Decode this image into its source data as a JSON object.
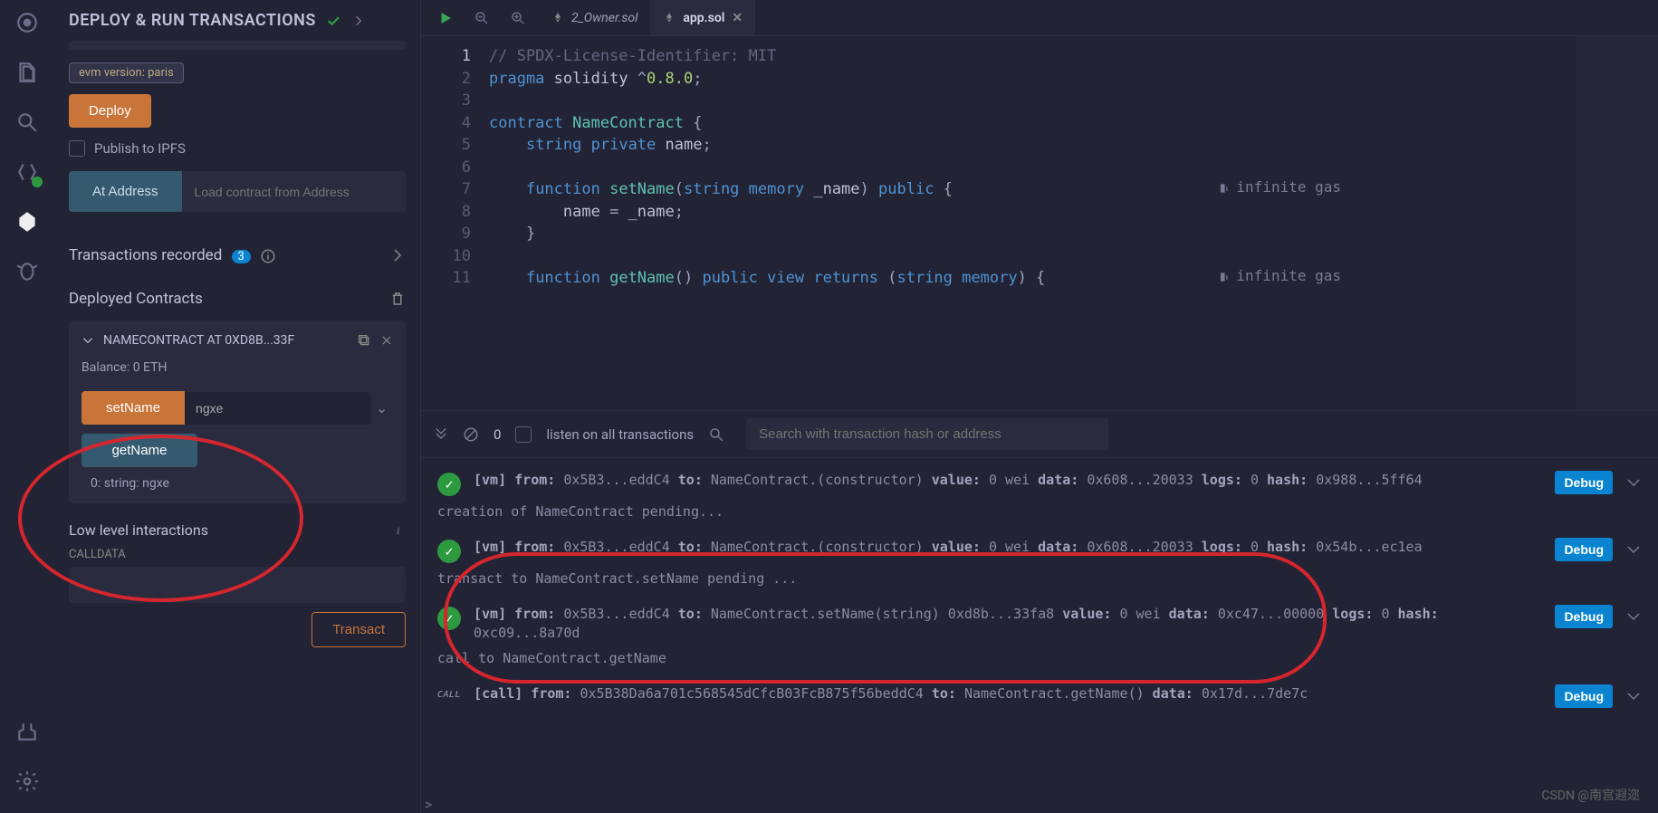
{
  "panel": {
    "title": "DEPLOY & RUN TRANSACTIONS",
    "evm_badge": "evm version: paris",
    "deploy_label": "Deploy",
    "publish_ipfs": "Publish to IPFS",
    "at_address_label": "At Address",
    "at_address_placeholder": "Load contract from Address",
    "tx_recorded": "Transactions recorded",
    "tx_recorded_count": "3",
    "deployed_contracts": "Deployed Contracts",
    "low_level": "Low level interactions",
    "calldata_label": "CALLDATA",
    "transact_label": "Transact"
  },
  "contract": {
    "name": "NAMECONTRACT AT 0XD8B...33F",
    "balance": "Balance: 0 ETH",
    "functions": [
      {
        "name": "setName",
        "input_value": "ngxe",
        "kind": "orange"
      },
      {
        "name": "getName",
        "kind": "blue"
      }
    ],
    "return_value": "0: string: ngxe"
  },
  "tabs": [
    {
      "label": "2_Owner.sol",
      "active": false
    },
    {
      "label": "app.sol",
      "active": true
    }
  ],
  "editor": {
    "lines": [
      {
        "n": 1,
        "tokens": [
          [
            "// SPDX-License-Identifier: MIT",
            "c-comment"
          ]
        ]
      },
      {
        "n": 2,
        "tokens": [
          [
            "pragma",
            "c-kw"
          ],
          [
            " ",
            "c-punc"
          ],
          [
            "solidity",
            "c-id"
          ],
          [
            " ^",
            "c-punc"
          ],
          [
            "0.8.0",
            "c-num"
          ],
          [
            ";",
            "c-punc"
          ]
        ]
      },
      {
        "n": 3,
        "tokens": []
      },
      {
        "n": 4,
        "tokens": [
          [
            "contract",
            "c-kw"
          ],
          [
            " ",
            "c-punc"
          ],
          [
            "NameContract",
            "c-type"
          ],
          [
            " {",
            "c-punc"
          ]
        ]
      },
      {
        "n": 5,
        "tokens": [
          [
            "    ",
            "c-punc"
          ],
          [
            "string",
            "c-kw"
          ],
          [
            " ",
            "c-punc"
          ],
          [
            "private",
            "c-kw"
          ],
          [
            " ",
            "c-punc"
          ],
          [
            "name",
            "c-id"
          ],
          [
            ";",
            "c-punc"
          ]
        ]
      },
      {
        "n": 6,
        "tokens": []
      },
      {
        "n": 7,
        "tokens": [
          [
            "    ",
            "c-punc"
          ],
          [
            "function",
            "c-kw"
          ],
          [
            " ",
            "c-punc"
          ],
          [
            "setName",
            "c-fn"
          ],
          [
            "(",
            "c-punc"
          ],
          [
            "string",
            "c-kw"
          ],
          [
            " ",
            "c-punc"
          ],
          [
            "memory",
            "c-kw"
          ],
          [
            " ",
            "c-punc"
          ],
          [
            "_name",
            "c-id"
          ],
          [
            ") ",
            "c-punc"
          ],
          [
            "public",
            "c-kw"
          ],
          [
            " {",
            "c-punc"
          ]
        ],
        "gas": "infinite gas"
      },
      {
        "n": 8,
        "tokens": [
          [
            "        name ",
            "c-id"
          ],
          [
            "=",
            "c-punc"
          ],
          [
            " _name",
            "c-id"
          ],
          [
            ";",
            "c-punc"
          ]
        ]
      },
      {
        "n": 9,
        "tokens": [
          [
            "    }",
            "c-punc"
          ]
        ]
      },
      {
        "n": 10,
        "tokens": []
      },
      {
        "n": 11,
        "tokens": [
          [
            "    ",
            "c-punc"
          ],
          [
            "function",
            "c-kw"
          ],
          [
            " ",
            "c-punc"
          ],
          [
            "getName",
            "c-fn"
          ],
          [
            "() ",
            "c-punc"
          ],
          [
            "public",
            "c-kw"
          ],
          [
            " ",
            "c-punc"
          ],
          [
            "view",
            "c-kw"
          ],
          [
            " ",
            "c-punc"
          ],
          [
            "returns",
            "c-kw"
          ],
          [
            " (",
            "c-punc"
          ],
          [
            "string",
            "c-kw"
          ],
          [
            " ",
            "c-punc"
          ],
          [
            "memory",
            "c-kw"
          ],
          [
            ") {",
            "c-punc"
          ]
        ],
        "gas": "infinite gas"
      }
    ]
  },
  "terminal": {
    "count": "0",
    "listen_label": "listen on all transactions",
    "search_placeholder": "Search with transaction hash or address",
    "debug_label": "Debug",
    "logs": [
      {
        "kind": "vm",
        "main": "[vm]  from: 0x5B3...eddC4 to: NameContract.(constructor) value: 0 wei data: 0x608...20033 logs: 0 hash: 0x988...5ff64",
        "pending": "creation of NameContract pending..."
      },
      {
        "kind": "vm",
        "main": "[vm]  from: 0x5B3...eddC4 to: NameContract.(constructor) value: 0 wei data: 0x608...20033 logs: 0 hash: 0x54b...ec1ea",
        "pending": "transact to NameContract.setName pending ..."
      },
      {
        "kind": "vm",
        "main": "[vm]  from: 0x5B3...eddC4 to: NameContract.setName(string) 0xd8b...33fa8 value: 0 wei data: 0xc47...00000 logs: 0 hash: 0xc09...8a70d",
        "pending": "call to NameContract.getName"
      },
      {
        "kind": "call",
        "main": "[call]  from: 0x5B38Da6a701c568545dCfcB03FcB875f56beddC4 to: NameContract.getName() data: 0x17d...7de7c"
      }
    ]
  },
  "watermark": "CSDN @南宫遐迩"
}
